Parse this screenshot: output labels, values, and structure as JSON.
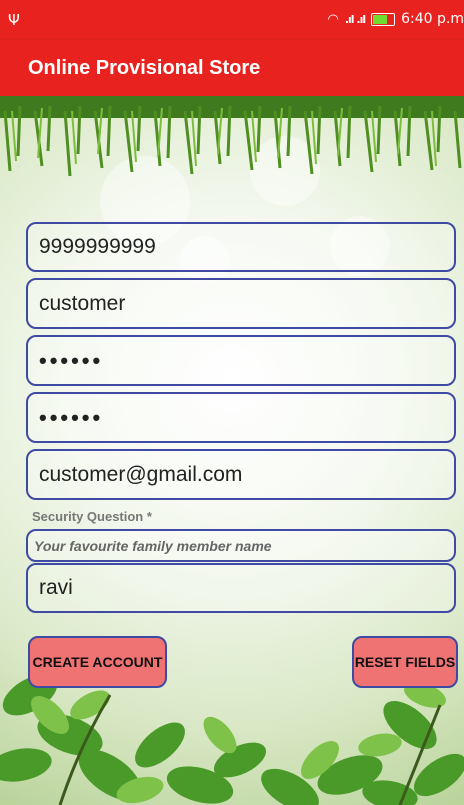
{
  "status_bar": {
    "usb_icon": "Ψ",
    "time": "6:40 p.m",
    "icons": [
      "wifi-icon",
      "signal-icon",
      "battery-icon"
    ],
    "battery_color": "#6fdc2e"
  },
  "app_bar": {
    "title": "Online Provisional Store",
    "color": "#e8231f"
  },
  "form": {
    "mobile_value": "9999999999",
    "username_value": "customer",
    "password_value": "••••••",
    "confirm_password_value": "••••••",
    "email_value": "customer@gmail.com",
    "security_question_label": "Security Question *",
    "security_question_value": "Your favourite family member name",
    "security_answer_value": "ravi"
  },
  "buttons": {
    "create_account": "CREATE ACCOUNT",
    "reset_fields": "RESET FIELDS",
    "button_color": "#f07373",
    "border_color": "#3e4aa3"
  }
}
